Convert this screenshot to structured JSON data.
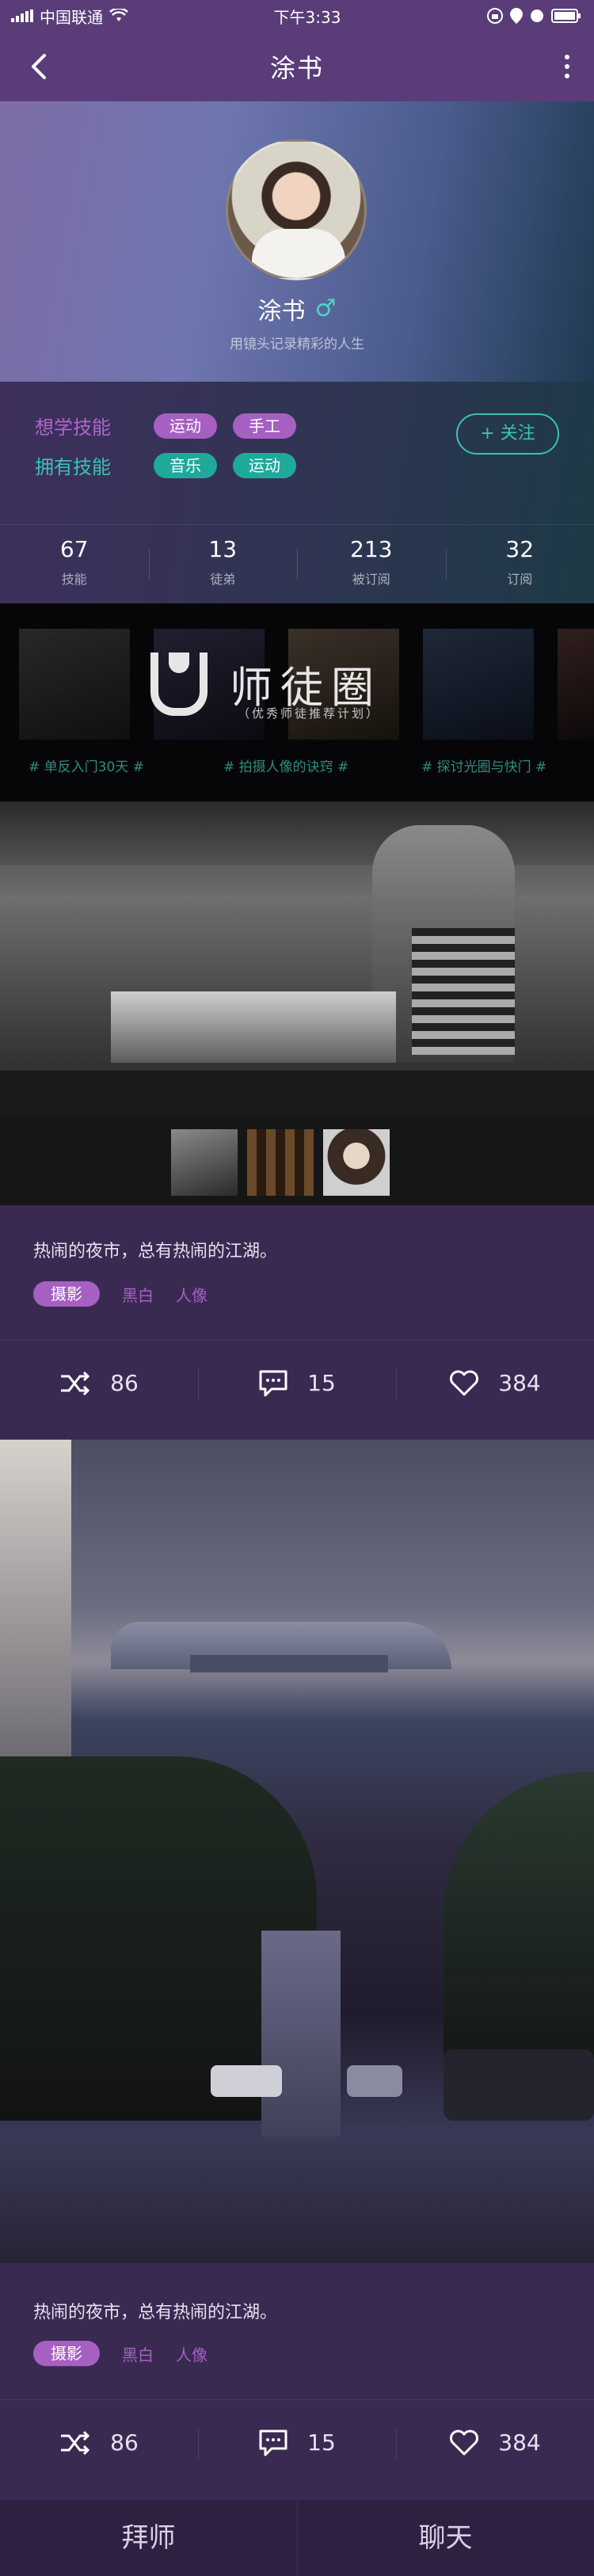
{
  "status_bar": {
    "carrier": "中国联通",
    "time": "下午3:33"
  },
  "nav": {
    "title": "涂书"
  },
  "profile": {
    "name": "涂书",
    "gender_symbol": "♂",
    "motto": "用镜头记录精彩的人生"
  },
  "skills": {
    "want_label": "想学技能",
    "want_tags": [
      "运动",
      "手工"
    ],
    "have_label": "拥有技能",
    "have_tags": [
      "音乐",
      "运动"
    ],
    "follow_label": "+ 关注"
  },
  "stats": [
    {
      "value": "67",
      "label": "技能"
    },
    {
      "value": "13",
      "label": "徒弟"
    },
    {
      "value": "213",
      "label": "被订阅"
    },
    {
      "value": "32",
      "label": "订阅"
    }
  ],
  "banner": {
    "logo_text": "师徒圈",
    "logo_sub": "（优秀师徒推荐计划）",
    "captions": [
      "# 单反入门30天 #",
      "# 拍摄人像的诀窍 #",
      "# 探讨光圈与快门 #"
    ]
  },
  "posts": [
    {
      "text": "热闹的夜市，总有热闹的江湖。",
      "main_tag": "摄影",
      "tags": [
        "黑白",
        "人像"
      ],
      "shuffle_count": "86",
      "comment_count": "15",
      "like_count": "384"
    },
    {
      "text": "热闹的夜市，总有热闹的江湖。",
      "main_tag": "摄影",
      "tags": [
        "黑白",
        "人像"
      ],
      "shuffle_count": "86",
      "comment_count": "15",
      "like_count": "384"
    }
  ],
  "bottom": {
    "left_label": "拜师",
    "right_label": "聊天"
  },
  "colors": {
    "accent_purple": "#a560c2",
    "accent_teal": "#1fa99b",
    "nav_bg": "#5a3d78"
  }
}
